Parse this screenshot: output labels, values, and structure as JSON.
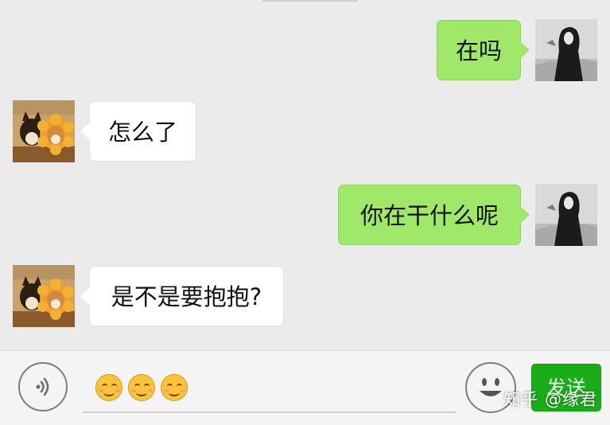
{
  "messages": [
    {
      "side": "out",
      "text": "在吗",
      "avatar": "user-avatar-woman-bw"
    },
    {
      "side": "in",
      "text": "怎么了",
      "avatar": "contact-avatar-shiba-flower"
    },
    {
      "side": "out",
      "text": "你在干什么呢",
      "avatar": "user-avatar-woman-bw"
    },
    {
      "side": "in",
      "text": "是不是要抱抱?",
      "avatar": "contact-avatar-shiba-flower"
    }
  ],
  "input": {
    "emojis": [
      "smiling-face-emoji",
      "smiling-face-emoji",
      "smiling-face-emoji"
    ],
    "voice_icon": "voice-icon",
    "sticker_icon": "smiley-icon"
  },
  "send_label": "发送",
  "watermark": "知乎 @缘君",
  "colors": {
    "outgoing_bubble": "#9fe86a",
    "incoming_bubble": "#ffffff",
    "background": "#ebebeb",
    "send_button": "#1aad19"
  }
}
